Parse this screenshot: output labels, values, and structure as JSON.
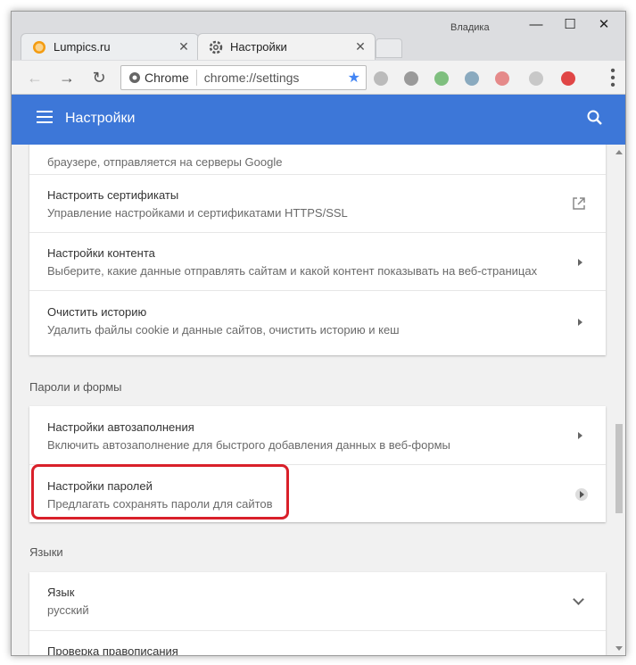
{
  "window": {
    "user": "Владика"
  },
  "tabs": [
    {
      "label": "Lumpics.ru"
    },
    {
      "label": "Настройки"
    }
  ],
  "omnibox": {
    "site": "Chrome",
    "url": "chrome://settings"
  },
  "header": {
    "title": "Настройки"
  },
  "sections": {
    "top_partial_sub": "браузере, отправляется на серверы Google",
    "certificates": {
      "title": "Настроить сертификаты",
      "sub": "Управление настройками и сертификатами HTTPS/SSL"
    },
    "content": {
      "title": "Настройки контента",
      "sub": "Выберите, какие данные отправлять сайтам и какой контент показывать на веб-страницах"
    },
    "history": {
      "title": "Очистить историю",
      "sub": "Удалить файлы cookie и данные сайтов, очистить историю и кеш"
    },
    "passwords_forms": "Пароли и формы",
    "autofill": {
      "title": "Настройки автозаполнения",
      "sub": "Включить автозаполнение для быстрого добавления данных в веб-формы"
    },
    "passwords": {
      "title": "Настройки паролей",
      "sub": "Предлагать сохранять пароли для сайтов"
    },
    "languages": "Языки",
    "language": {
      "title": "Язык",
      "sub": "русский"
    },
    "spellcheck": {
      "title": "Проверка правописания"
    }
  },
  "colors": {
    "header": "#3d77d8",
    "highlight": "#d9202a"
  }
}
